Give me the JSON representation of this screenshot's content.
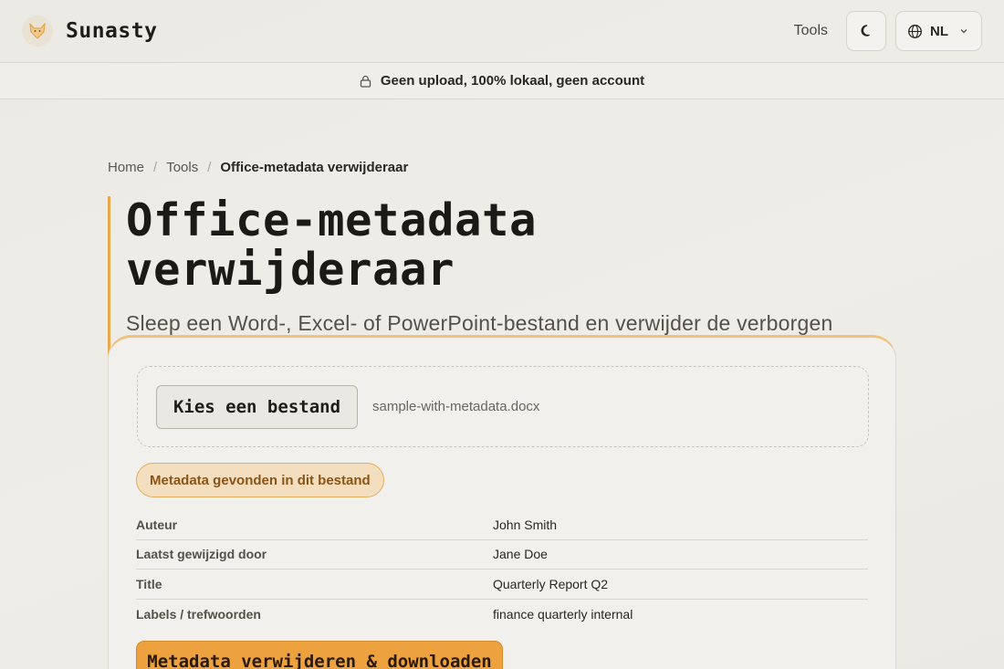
{
  "header": {
    "brand_name": "Sunasty",
    "logo_icon": "fox-logo-icon",
    "nav_tools": "Tools",
    "theme_icon": "moon-icon",
    "lang_icon": "globe-icon",
    "lang_label": "NL",
    "lang_chevron": "chevron-down-icon"
  },
  "banner": {
    "icon": "lock-icon",
    "text": "Geen upload, 100% lokaal, geen account"
  },
  "breadcrumb": {
    "items": [
      "Home",
      "Tools"
    ],
    "separator": "/",
    "current": "Office-metadata verwijderaar"
  },
  "hero": {
    "title": "Office-metadata verwijderaar",
    "description": "Sleep een Word-, Excel- of PowerPoint-bestand en verwijder de verborgen auteur-/bedrijf-/datumeigenschappen. Alles blijft op je apparaat."
  },
  "card": {
    "choose_button": "Kies een bestand",
    "filename": "sample-with-metadata.docx",
    "badge": "Metadata gevonden in dit bestand",
    "metadata": [
      {
        "key": "Auteur",
        "value": "John Smith"
      },
      {
        "key": "Laatst gewijzigd door",
        "value": "Jane Doe"
      },
      {
        "key": "Title",
        "value": "Quarterly Report Q2"
      },
      {
        "key": "Labels / trefwoorden",
        "value": "finance quarterly internal"
      }
    ],
    "primary_button": "Metadata verwijderen & downloaden"
  },
  "colors": {
    "accent": "#eda13f",
    "badge_bg": "#f3dfbf",
    "badge_text": "#8b5417",
    "hero_rule": "#eaa84a"
  }
}
